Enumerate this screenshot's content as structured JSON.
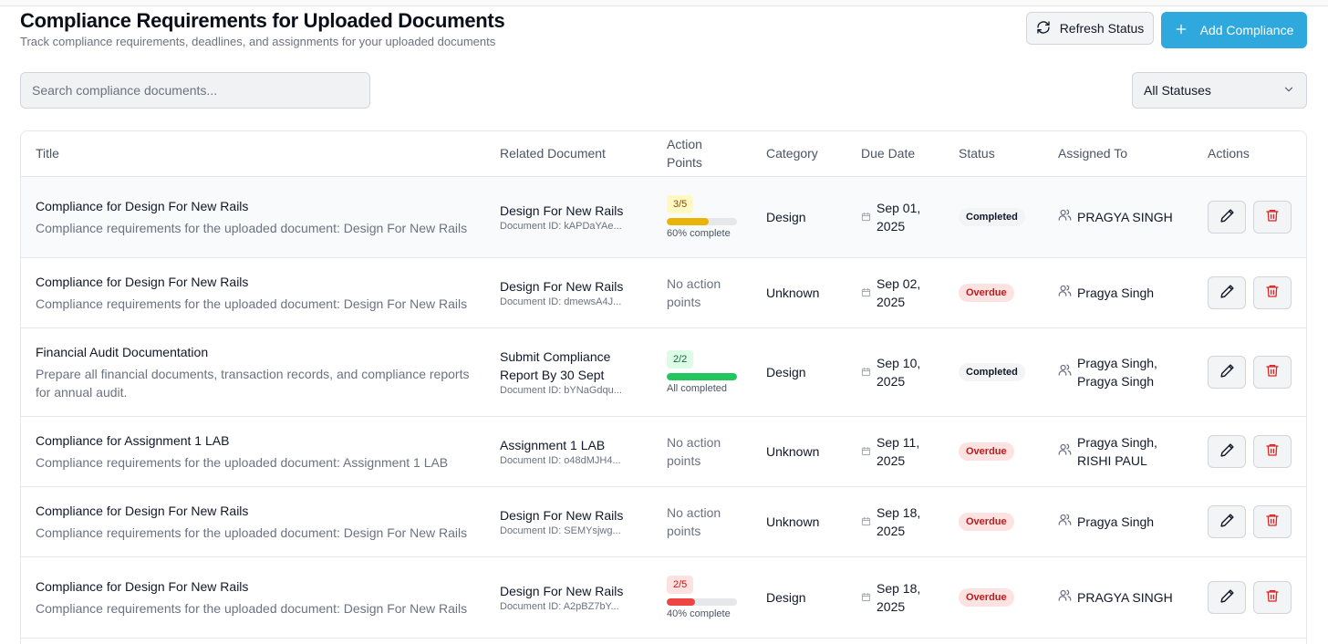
{
  "header": {
    "title": "Compliance Requirements for Uploaded Documents",
    "subtitle": "Track compliance requirements, deadlines, and assignments for your uploaded documents",
    "refresh_label": "Refresh Status",
    "add_label": "Add Compliance"
  },
  "filters": {
    "search_placeholder": "Search compliance documents...",
    "status_selected": "All Statuses"
  },
  "table": {
    "columns": [
      "Title",
      "Related Document",
      "Action Points",
      "Category",
      "Due Date",
      "Status",
      "Assigned To",
      "Actions"
    ],
    "rows": [
      {
        "title": "Compliance for Design For New Rails",
        "description": "Compliance requirements for the uploaded document: Design For New Rails",
        "doc_name": "Design For New Rails",
        "doc_id": "Document ID: kAPDaYAe...",
        "ap_label": "3/5",
        "ap_text": "60% complete",
        "ap_fraction": 0.6,
        "ap_color": "#eab308",
        "ap_badge_bg": "#fef9c3",
        "ap_badge_fg": "#854d0e",
        "category": "Design",
        "due": "Sep 01, 2025",
        "status": "Completed",
        "status_kind": "completed",
        "assigned": "PRAGYA SINGH"
      },
      {
        "title": "Compliance for Design For New Rails",
        "description": "Compliance requirements for the uploaded document: Design For New Rails",
        "doc_name": "Design For New Rails",
        "doc_id": "Document ID: dmewsA4J...",
        "ap_label": "",
        "ap_text": "No action points",
        "category": "Unknown",
        "due": "Sep 02, 2025",
        "status": "Overdue",
        "status_kind": "overdue",
        "assigned": "Pragya Singh"
      },
      {
        "title": "Financial Audit Documentation",
        "description": "Prepare all financial documents, transaction records, and compliance reports for annual audit.",
        "doc_name": "Submit Compliance Report By 30 Sept",
        "doc_id": "Document ID: bYNaGdqu...",
        "ap_label": "2/2",
        "ap_text": "All completed",
        "ap_fraction": 1,
        "ap_color": "#22c55e",
        "ap_badge_bg": "#dcfce7",
        "ap_badge_fg": "#166534",
        "category": "Design",
        "due": "Sep 10, 2025",
        "status": "Completed",
        "status_kind": "completed",
        "assigned": "Pragya Singh, Pragya Singh"
      },
      {
        "title": "Compliance for Assignment 1 LAB",
        "description": "Compliance requirements for the uploaded document: Assignment 1 LAB",
        "doc_name": "Assignment 1 LAB",
        "doc_id": "Document ID: o48dMJH4...",
        "ap_label": "",
        "ap_text": "No action points",
        "category": "Unknown",
        "due": "Sep 11, 2025",
        "status": "Overdue",
        "status_kind": "overdue",
        "assigned": "Pragya Singh, RISHI PAUL"
      },
      {
        "title": "Compliance for Design For New Rails",
        "description": "Compliance requirements for the uploaded document: Design For New Rails",
        "doc_name": "Design For New Rails",
        "doc_id": "Document ID: SEMYsjwg...",
        "ap_label": "",
        "ap_text": "No action points",
        "category": "Unknown",
        "due": "Sep 18, 2025",
        "status": "Overdue",
        "status_kind": "overdue",
        "assigned": "Pragya Singh"
      },
      {
        "title": "Compliance for Design For New Rails",
        "description": "Compliance requirements for the uploaded document: Design For New Rails",
        "doc_name": "Design For New Rails",
        "doc_id": "Document ID: A2pBZ7bY...",
        "ap_label": "2/5",
        "ap_text": "40% complete",
        "ap_fraction": 0.4,
        "ap_color": "#ef4444",
        "ap_badge_bg": "#fee2e2",
        "ap_badge_fg": "#b91c1c",
        "category": "Design",
        "due": "Sep 18, 2025",
        "status": "Overdue",
        "status_kind": "overdue",
        "assigned": "PRAGYA SINGH"
      }
    ]
  },
  "colors": {
    "primary": "#2fa8dd",
    "danger": "#dc2626"
  },
  "icons": {
    "refresh": "refresh-icon",
    "add": "plus-icon",
    "dropdown": "chevron-down-icon",
    "calendar": "calendar-icon",
    "users": "users-icon",
    "edit": "pencil-icon",
    "delete": "trash-icon"
  }
}
